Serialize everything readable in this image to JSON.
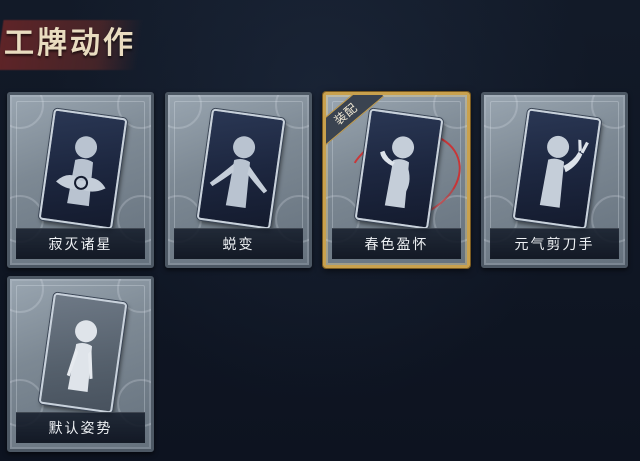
{
  "header": {
    "title": "工牌动作"
  },
  "cards": [
    {
      "label": "寂灭诸星",
      "selected": false,
      "locked": false
    },
    {
      "label": "蜕变",
      "selected": false,
      "locked": false
    },
    {
      "label": "春色盈怀",
      "selected": true,
      "locked": false,
      "badge": "装配"
    },
    {
      "label": "元气剪刀手",
      "selected": false,
      "locked": false
    },
    {
      "label": "默认姿势",
      "selected": false,
      "locked": false
    }
  ],
  "colors": {
    "background": "#0e1420",
    "header_text": "#e9dcc0",
    "header_band": "#7a2828",
    "card_frame": "#7d8994",
    "selected_border": "#c9a14d",
    "highlight_ring": "#d62828"
  },
  "icons": {
    "pose_1": "silhouette-star-pose-icon",
    "pose_2": "silhouette-open-arms-icon",
    "pose_3": "silhouette-hand-near-face-icon",
    "pose_4": "silhouette-victory-sign-icon",
    "pose_5": "silhouette-default-pose-icon"
  }
}
